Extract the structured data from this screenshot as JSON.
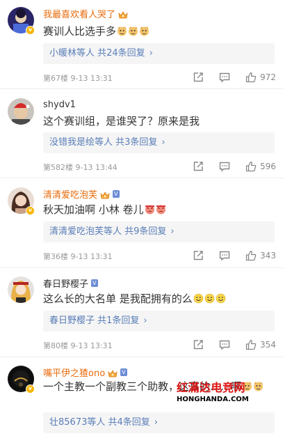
{
  "comments": [
    {
      "username": "我最喜欢看人哭了",
      "text": "赛训人比选手多",
      "reply_summary": "小暖林等人 共24条回复",
      "meta": "第67楼  9-13 13:31",
      "likes": "972"
    },
    {
      "username": "shydv1",
      "text": "这个赛训组，是谁哭了？原来是我",
      "reply_summary": "没错我是绘等人 共3条回复",
      "meta": "第582楼  9-13 13:44",
      "likes": "596"
    },
    {
      "username": "清清爱吃泡芙",
      "text": "秋天加油啊 小林 卷儿",
      "reply_summary": "清清爱吃泡芙等人 共9条回复",
      "meta": "第36楼  9-13 13:31",
      "likes": "343"
    },
    {
      "username": "春日野樱子",
      "text": "这么长的大名单 是我配拥有的么",
      "reply_summary": "春日野樱子 共1条回复",
      "meta": "第80楼  9-13 13:31",
      "likes": "354"
    },
    {
      "username": "嘴平伊之猹ono",
      "text": "一个主教一个副教三个助教，这真的……啊",
      "reply_summary": "壮85673等人 共4条回复",
      "likes": ""
    }
  ],
  "watermark": {
    "title": "红滿达电竞网",
    "url": "HONGHANDA.COM"
  },
  "colors": {
    "vip_name": "#e86b0c",
    "link_blue": "#5a7eb8",
    "meta_grey": "#999999"
  }
}
